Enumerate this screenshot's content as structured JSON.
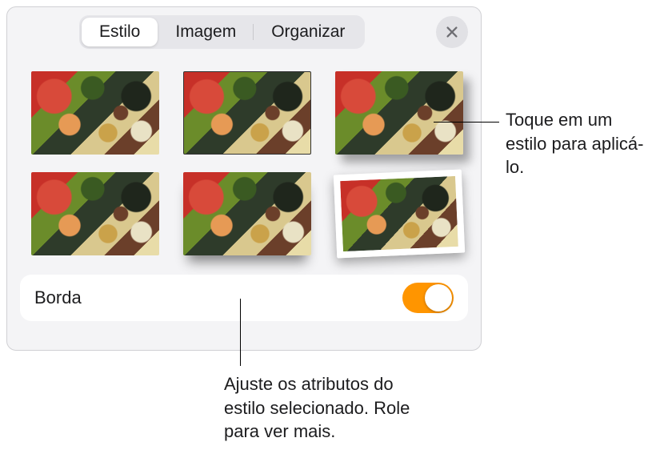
{
  "tabs": {
    "style": "Estilo",
    "image": "Imagem",
    "arrange": "Organizar",
    "active": "style"
  },
  "styles": [
    {
      "variant": "plain"
    },
    {
      "variant": "thin-border"
    },
    {
      "variant": "shadow"
    },
    {
      "variant": "plain"
    },
    {
      "variant": "drop-shadow"
    },
    {
      "variant": "tilted"
    }
  ],
  "options": {
    "border": {
      "label": "Borda",
      "on": true
    }
  },
  "callouts": {
    "style_tap": "Toque em um estilo para aplicá-lo.",
    "attributes": "Ajuste os atributos do estilo selecionado. Role para ver mais."
  },
  "colors": {
    "accent": "#ff9500"
  }
}
